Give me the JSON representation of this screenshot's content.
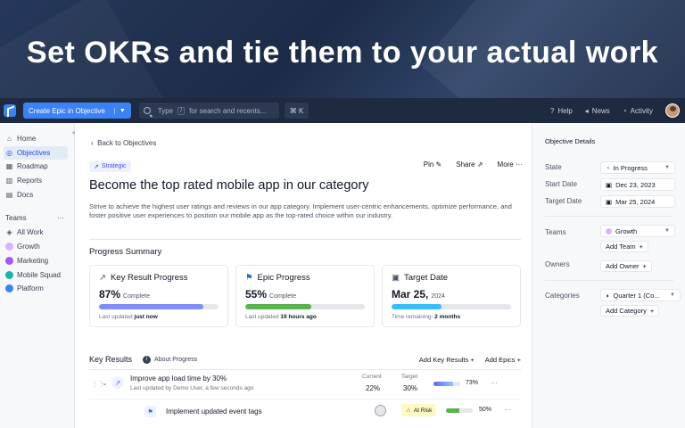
{
  "hero": {
    "headline": "Set OKRs and tie them to your actual work"
  },
  "topbar": {
    "create_button": "Create Epic in Objective",
    "search_prefix": "Type",
    "search_slash": "/",
    "search_suffix": "for search and recents...",
    "shortcut": "⌘ K",
    "help": "Help",
    "news": "News",
    "activity": "Activity"
  },
  "sidebar": {
    "items": [
      {
        "label": "Home",
        "icon": "home-icon"
      },
      {
        "label": "Objectives",
        "icon": "target-icon"
      },
      {
        "label": "Roadmap",
        "icon": "roadmap-icon"
      },
      {
        "label": "Reports",
        "icon": "chart-icon"
      },
      {
        "label": "Docs",
        "icon": "doc-icon"
      }
    ],
    "teams_header": "Teams",
    "teams_more": "···",
    "teams": [
      {
        "label": "All Work",
        "color": "#6b7280"
      },
      {
        "label": "Growth",
        "color": "#d8b4fe"
      },
      {
        "label": "Marketing",
        "color": "#a855f7"
      },
      {
        "label": "Mobile Squad",
        "color": "#14b8a6"
      },
      {
        "label": "Platform",
        "color": "#3b82f6"
      }
    ]
  },
  "main": {
    "back_link": "Back to Objectives",
    "tag": "Strategic",
    "actions": {
      "pin": "Pin",
      "share": "Share",
      "more": "More"
    },
    "title": "Become the top rated mobile app in our category",
    "description": "Strive to achieve the highest user ratings and reviews in our app category. Implement user-centric enhancements, optimize performance, and foster positive user experiences to position our mobile app as the top-rated choice within our industry.",
    "progress_summary": "Progress Summary",
    "cards": [
      {
        "title": "Key Result Progress",
        "value": "87%",
        "value_suffix": "Complete",
        "progress": 0.87,
        "color": "#818cf8",
        "foot_prefix": "Last updated",
        "foot_value": "just now"
      },
      {
        "title": "Epic Progress",
        "value": "55%",
        "value_suffix": "Complete",
        "progress": 0.55,
        "color": "#5bb14e",
        "foot_prefix": "Last updated",
        "foot_value": "19 hours ago"
      },
      {
        "title": "Target Date",
        "value": "Mar 25,",
        "value_suffix": "2024",
        "progress": 0.42,
        "color": "#38bdf8",
        "foot_prefix": "Time remaining:",
        "foot_value": "2 months"
      }
    ],
    "key_results": {
      "title": "Key Results",
      "about": "About Progress",
      "add_kr": "Add Key Results",
      "add_epics": "Add Epics",
      "col_current": "Current",
      "col_target": "Target",
      "rows": [
        {
          "title": "Improve app load time by 30%",
          "sub_prefix": "Last updated by",
          "sub_user": "Demo User",
          "sub_time": ", a few seconds ago",
          "current": "22%",
          "target": "30%",
          "pct": "73%",
          "progress": 0.73
        },
        {
          "title": "Implement updated event tags",
          "status": "At Risk",
          "pct": "50%",
          "progress": 0.5
        }
      ]
    }
  },
  "details": {
    "header": "Objective Details",
    "state_label": "State",
    "state_value": "In Progress",
    "start_label": "Start Date",
    "start_value": "Dec 23, 2023",
    "target_label": "Target Date",
    "target_value": "Mar 25, 2024",
    "teams_label": "Teams",
    "teams_value": "Growth",
    "add_team": "Add Team",
    "owners_label": "Owners",
    "add_owner": "Add Owner",
    "categories_label": "Categories",
    "categories_value": "Quarter 1 (Co...",
    "add_category": "Add Category"
  }
}
